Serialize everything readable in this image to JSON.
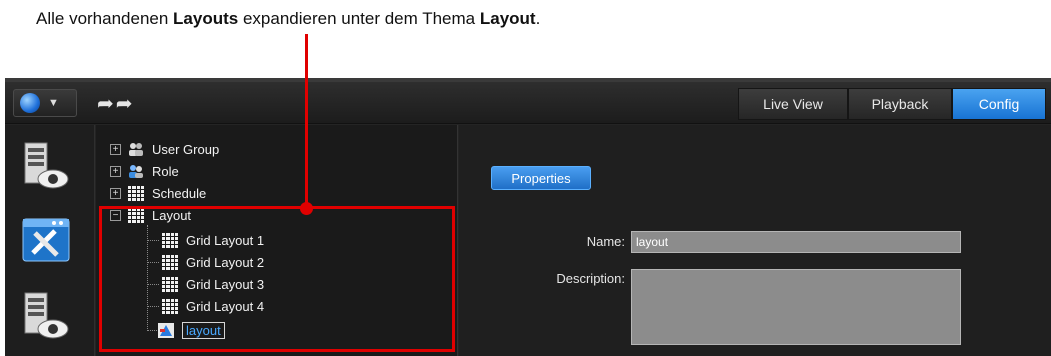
{
  "caption": {
    "part1": "Alle vorhandenen ",
    "bold1": "Layouts",
    "part2": " expandieren unter dem Thema ",
    "bold2": "Layout",
    "part3": "."
  },
  "colors": {
    "callout": "#e00000",
    "accent": "#1f7ad6"
  },
  "toolbar": {
    "globe_icon": "globe-icon",
    "arrows_text": "➦➦",
    "tabs": [
      {
        "label": "Live View",
        "active": false
      },
      {
        "label": "Playback",
        "active": false
      },
      {
        "label": "Config",
        "active": true
      }
    ]
  },
  "sidebar": {
    "icons": [
      "server-eye-icon",
      "config-tools-icon",
      "server-eye-icon"
    ]
  },
  "tree": {
    "roots": [
      {
        "label": "User Group",
        "expander": "⊞",
        "icon": "user-group-icon"
      },
      {
        "label": "Role",
        "expander": "⊞",
        "icon": "role-icon"
      },
      {
        "label": "Schedule",
        "expander": "⊞",
        "icon": "schedule-icon"
      },
      {
        "label": "Layout",
        "expander": "⊟",
        "icon": "layout-icon"
      }
    ],
    "children": [
      {
        "label": "Grid Layout 1"
      },
      {
        "label": "Grid Layout 2"
      },
      {
        "label": "Grid Layout 3"
      },
      {
        "label": "Grid Layout 4"
      },
      {
        "label": "layout",
        "selected": true
      }
    ]
  },
  "properties": {
    "button_label": "Properties",
    "name_label": "Name:",
    "name_value": "layout",
    "description_label": "Description:",
    "description_value": ""
  }
}
